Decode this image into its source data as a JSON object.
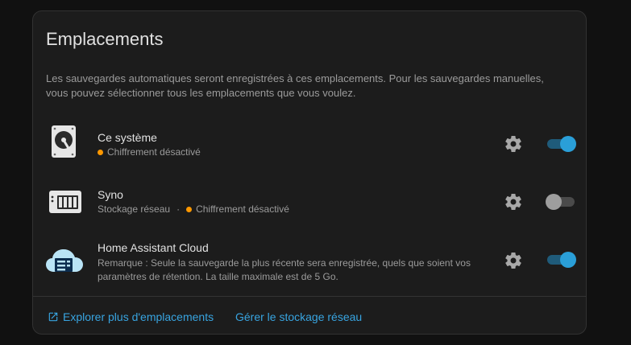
{
  "section": {
    "title": "Emplacements",
    "description": "Les sauvegardes automatiques seront enregistrées à ces emplacements. Pour les sauvegardes manuelles, vous pouvez sélectionner tous les emplacements que vous voulez."
  },
  "locations": [
    {
      "icon": "hard-disk-icon",
      "name": "Ce système",
      "status": "Chiffrement désactivé",
      "enabled": true
    },
    {
      "icon": "nas-icon",
      "name": "Syno",
      "type": "Stockage réseau",
      "separator": "·",
      "status": "Chiffrement désactivé",
      "enabled": false
    },
    {
      "icon": "cloud-icon",
      "name": "Home Assistant Cloud",
      "note_line1": "Remarque : Seule la sauvegarde la plus récente sera enregistrée, quels que soient vos",
      "note_line2": "paramètres de rétention. La taille maximale est de 5 Go.",
      "enabled": true
    }
  ],
  "footer": {
    "explore_label": "Explorer plus d'emplacements",
    "manage_label": "Gérer le stockage réseau"
  },
  "colors": {
    "accent": "#38a4e0",
    "toggle_on": "#2a9fd8",
    "warning_dot": "#ff9800",
    "card_bg": "#1c1c1c",
    "page_bg": "#111111"
  }
}
